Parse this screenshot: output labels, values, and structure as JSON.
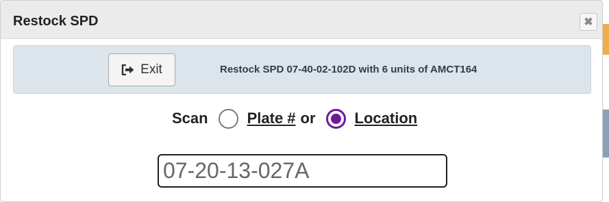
{
  "dialog": {
    "title": "Restock SPD",
    "close_icon": "times-icon"
  },
  "info": {
    "exit_label": "Exit",
    "exit_icon": "sign-out-icon",
    "message": "Restock SPD 07-40-02-102D with 6 units of AMCT164"
  },
  "scan": {
    "label": "Scan",
    "option_plate": "Plate #",
    "or_text": "or",
    "option_location": "Location",
    "selected": "Location",
    "input_value": "07-20-13-027A"
  },
  "colors": {
    "radio_selected": "#6a1b9a",
    "info_panel_bg": "#dce5eb",
    "titlebar_bg": "#ebebeb"
  }
}
